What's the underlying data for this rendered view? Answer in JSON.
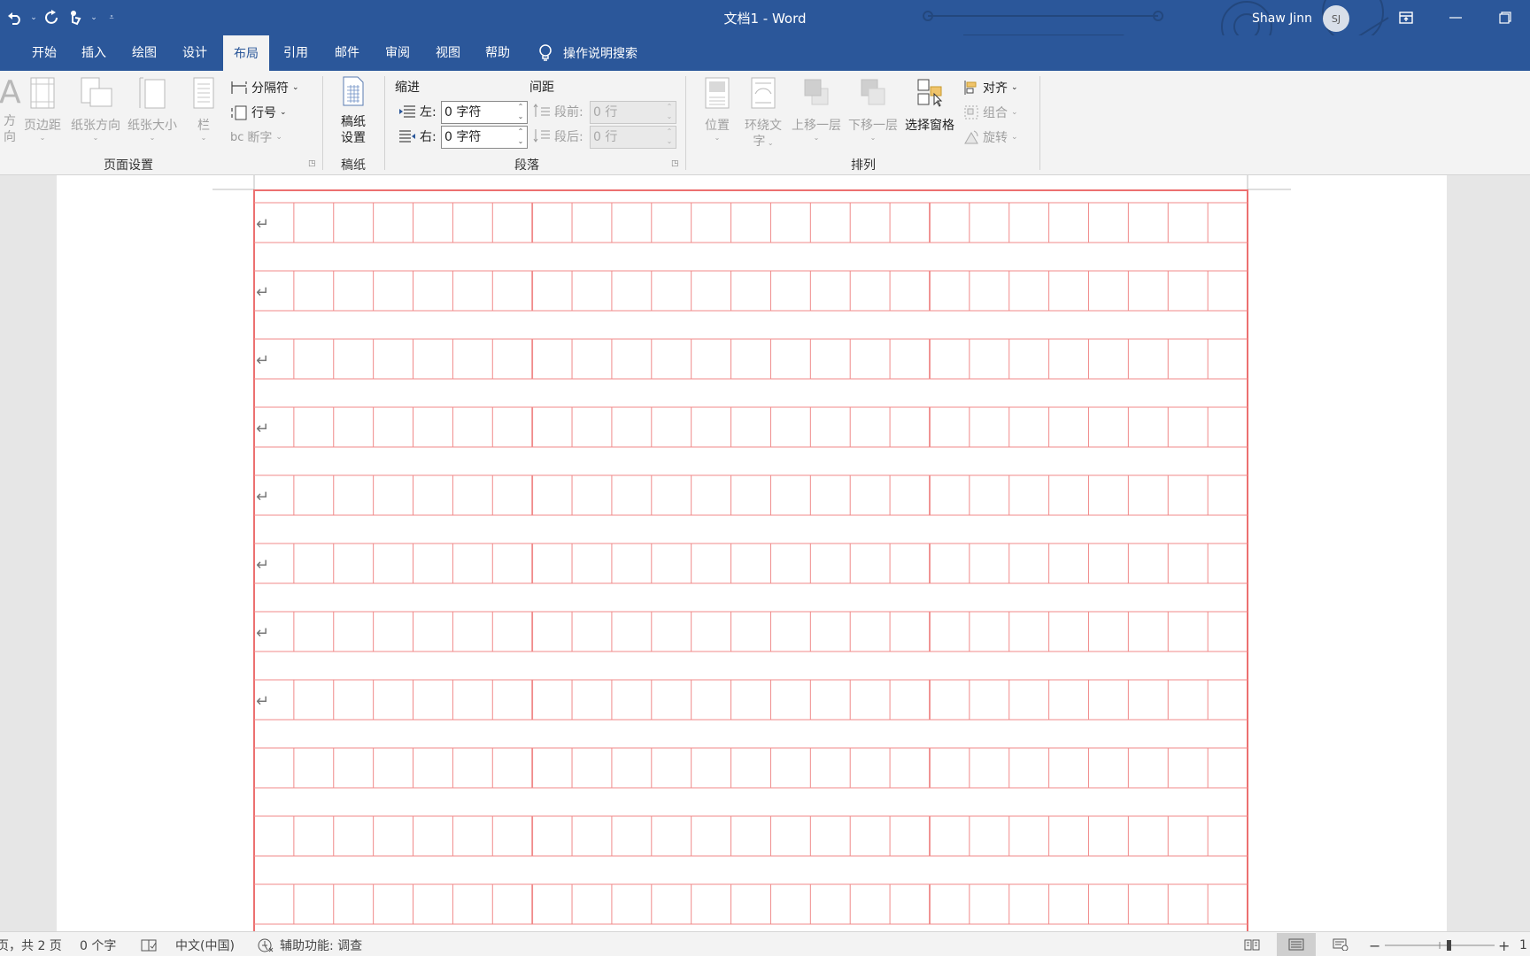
{
  "title_bar": {
    "title": "文档1  -  Word",
    "user_name": "Shaw Jinn",
    "user_initials": "SJ"
  },
  "tabs": [
    "开始",
    "插入",
    "绘图",
    "设计",
    "布局",
    "引用",
    "邮件",
    "审阅",
    "视图",
    "帮助"
  ],
  "active_tab": "布局",
  "tell_me": "操作说明搜索",
  "ribbon": {
    "page_setup": {
      "label": "页面设置",
      "direction_partial": "方向",
      "margins": "页边距",
      "orientation": "纸张方向",
      "size": "纸张大小",
      "columns": "栏",
      "breaks": "分隔符",
      "line_numbers": "行号",
      "hyphenation": "断字"
    },
    "manuscript": {
      "label": "稿纸",
      "button_line1": "稿纸",
      "button_line2": "设置"
    },
    "paragraph": {
      "label": "段落",
      "indent_title": "缩进",
      "spacing_title": "间距",
      "left_label": "左:",
      "right_label": "右:",
      "left_value": "0 字符",
      "right_value": "0 字符",
      "before_label": "段前:",
      "after_label": "段后:",
      "before_value": "0 行",
      "after_value": "0 行"
    },
    "arrange": {
      "label": "排列",
      "position": "位置",
      "wrap_line1": "环绕文",
      "wrap_line2": "字",
      "bring_forward": "上移一层",
      "send_backward": "下移一层",
      "selection_pane": "选择窗格",
      "align": "对齐",
      "group": "组合",
      "rotate": "旋转"
    }
  },
  "status_bar": {
    "page_info": "页，共 2 页",
    "word_count": "0 个字",
    "language": "中文(中国)",
    "accessibility": "辅助功能: 调查",
    "zoom_partial": "1"
  },
  "colors": {
    "title_bar": "#2b579a",
    "grid_line": "#f08a8a",
    "grid_border": "#ec7070",
    "ribbon_bg": "#f3f3f3"
  },
  "manuscript_grid": {
    "columns": 25,
    "rows_visible": 11,
    "paragraph_marks_rows": 8,
    "paragraph_mark": "↵"
  }
}
